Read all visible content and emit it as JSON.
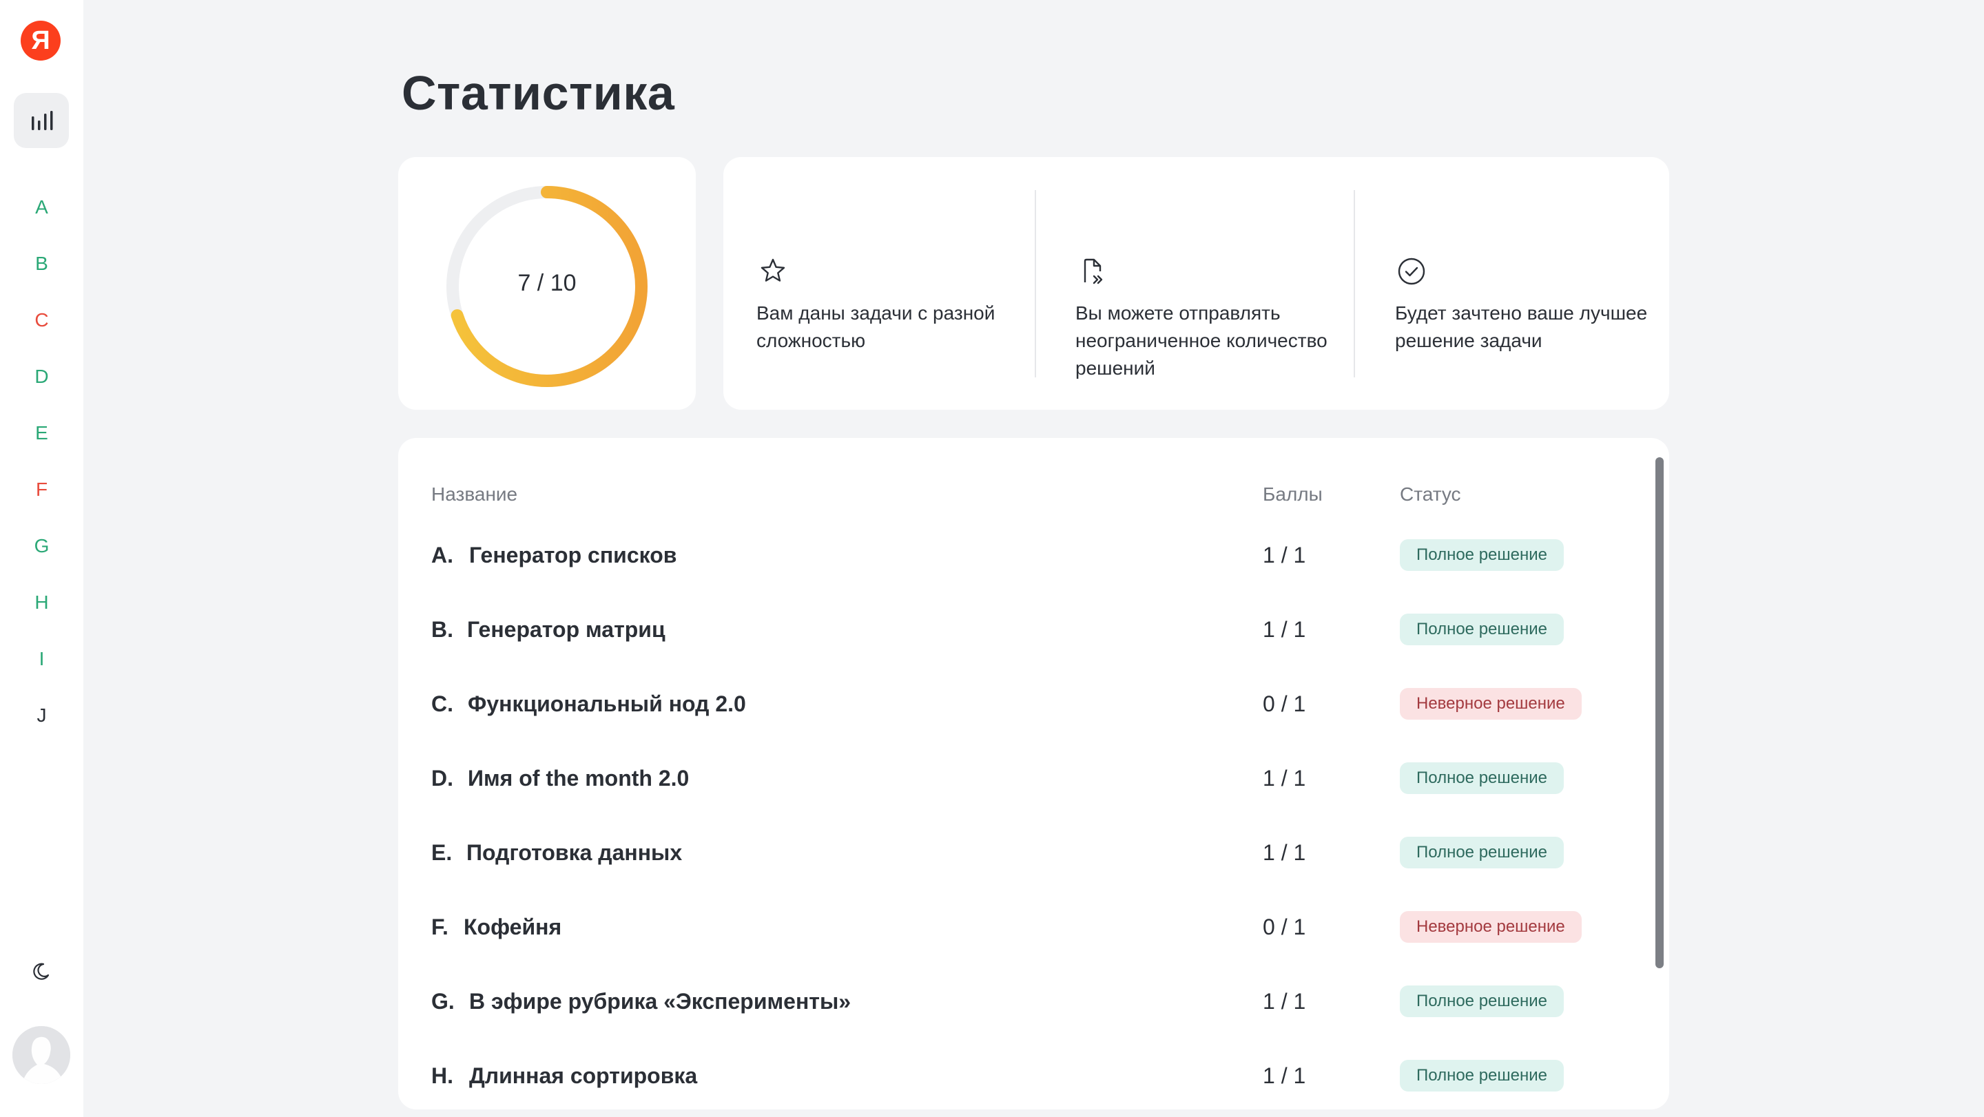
{
  "sidebar": {
    "logo": "Я",
    "letters": [
      {
        "label": "A",
        "color": "#2aa876"
      },
      {
        "label": "B",
        "color": "#2aa876"
      },
      {
        "label": "C",
        "color": "#e84b3c"
      },
      {
        "label": "D",
        "color": "#2aa876"
      },
      {
        "label": "E",
        "color": "#2aa876"
      },
      {
        "label": "F",
        "color": "#e84b3c"
      },
      {
        "label": "G",
        "color": "#2aa876"
      },
      {
        "label": "H",
        "color": "#2aa876"
      },
      {
        "label": "I",
        "color": "#2aa876"
      },
      {
        "label": "J",
        "color": "#2b2f36"
      }
    ]
  },
  "page": {
    "title": "Статистика"
  },
  "progress": {
    "text": "7 / 10",
    "solved": 7,
    "total": 10
  },
  "info": [
    {
      "icon": "star-icon",
      "text": "Вам даны задачи с разной сложностью"
    },
    {
      "icon": "file-forward-icon",
      "text": "Вы можете отправлять неограниченное количество решений"
    },
    {
      "icon": "check-circle-icon",
      "text": "Будет зачтено ваше лучшее решение задачи"
    }
  ],
  "table": {
    "headers": {
      "name": "Название",
      "score": "Баллы",
      "status": "Статус"
    },
    "rows": [
      {
        "letter": "A.",
        "name": "Генератор списков",
        "score": "1 / 1",
        "status": "Полное решение",
        "ok": true
      },
      {
        "letter": "B.",
        "name": "Генератор матриц",
        "score": "1 / 1",
        "status": "Полное решение",
        "ok": true
      },
      {
        "letter": "C.",
        "name": "Функциональный нод 2.0",
        "score": "0 / 1",
        "status": "Неверное решение",
        "ok": false
      },
      {
        "letter": "D.",
        "name": "Имя of the month 2.0",
        "score": "1 / 1",
        "status": "Полное решение",
        "ok": true
      },
      {
        "letter": "E.",
        "name": "Подготовка данных",
        "score": "1 / 1",
        "status": "Полное решение",
        "ok": true
      },
      {
        "letter": "F.",
        "name": "Кофейня",
        "score": "0 / 1",
        "status": "Неверное решение",
        "ok": false
      },
      {
        "letter": "G.",
        "name": "В эфире рубрика «Эксперименты»",
        "score": "1 / 1",
        "status": "Полное решение",
        "ok": true
      },
      {
        "letter": "H.",
        "name": "Длинная сортировка",
        "score": "1 / 1",
        "status": "Полное решение",
        "ok": true
      }
    ]
  },
  "colors": {
    "accent_start": "#f5c33b",
    "accent_end": "#f2a335",
    "ok_bg": "#dff3ef",
    "bad_bg": "#fbe2e3"
  }
}
